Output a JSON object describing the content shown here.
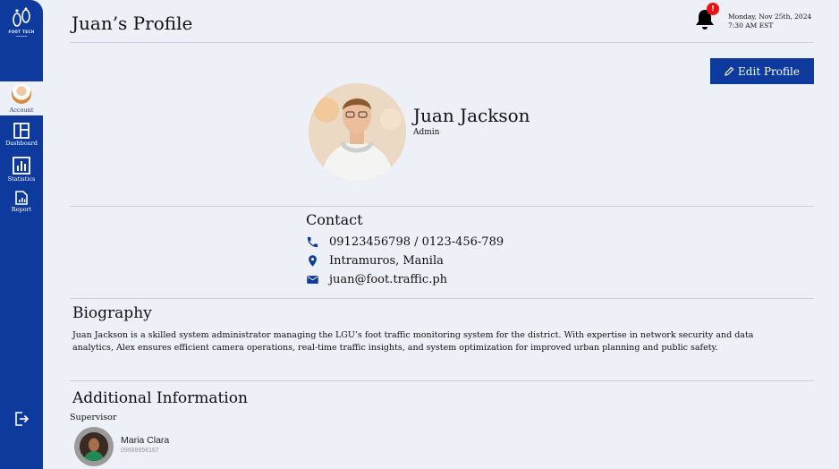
{
  "sidebar": {
    "brand": "FOOT TECH",
    "items": [
      {
        "label": "Account",
        "icon": "user-avatar"
      },
      {
        "label": "Dashboard",
        "icon": "dashboard-icon"
      },
      {
        "label": "Statistics",
        "icon": "bar-chart-icon"
      },
      {
        "label": "Report",
        "icon": "report-icon"
      }
    ],
    "logout_icon": "logout-icon"
  },
  "header": {
    "title": "Juan’s Profile",
    "notification_badge": "!",
    "date": "Monday, Nov 25th, 2024",
    "time": "7:30 AM EST"
  },
  "actions": {
    "edit_profile": "Edit Profile"
  },
  "profile": {
    "name": "Juan Jackson",
    "role": "Admin"
  },
  "contact": {
    "title": "Contact",
    "phone": "09123456798 / 0123-456-789",
    "location": "Intramuros, Manila",
    "email": "juan@foot.traffic.ph"
  },
  "biography": {
    "title": "Biography",
    "text": "Juan Jackson is a skilled system administrator managing the LGU’s foot traffic monitoring system for the district. With expertise in network security and data analytics, Alex ensures efficient camera operations, real-time traffic insights, and system optimization for improved urban planning and public safety."
  },
  "additional": {
    "title": "Additional Information",
    "supervisor_label": "Supervisor",
    "supervisor_name": "Maria Clara",
    "supervisor_phone": "09688956167"
  },
  "colors": {
    "primary": "#0d3a9c",
    "background": "#eef0f7",
    "badge": "#e11111"
  }
}
